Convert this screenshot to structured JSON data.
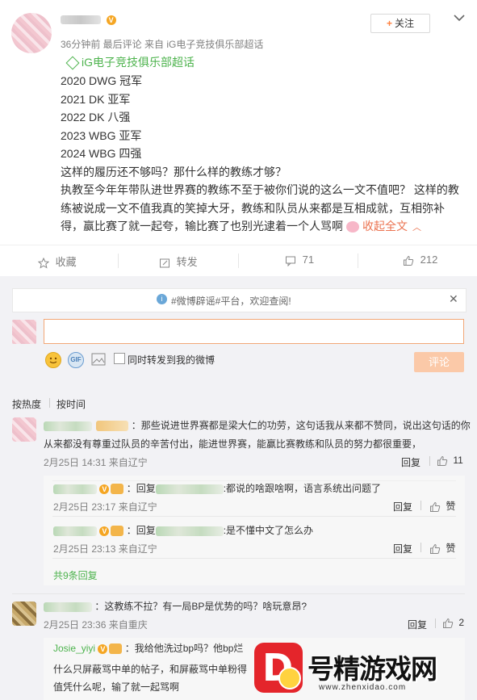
{
  "post": {
    "author_name": "Josie_yiyi",
    "meta": "36分钟前 最后评论 来自 iG电子竞技俱乐部超话",
    "follow_label": "关注",
    "topic_tag": "iG电子竞技俱乐部超话",
    "lines": [
      "2020 DWG 冠军",
      "2021 DK 亚军",
      "2022 DK 八强",
      "2023 WBG 亚军",
      "2024 WBG 四强",
      "这样的履历还不够吗？那什么样的教练才够？",
      "执教至今年年带队进世界赛的教练不至于被你们说的这么一文不值吧？ 这样的教",
      "练被说成一文不值我真的笑掉大牙，教练和队员从来都是互相成就，互相弥补",
      "得，赢比赛了就一起夸，输比赛了也别光逮着一个人骂啊"
    ],
    "collapse_label": "收起全文"
  },
  "actions": {
    "favorite": "收藏",
    "repost": "转发",
    "comments": "71",
    "likes": "212"
  },
  "notice": {
    "text": "#微博辟谣#平台，欢迎查阅!"
  },
  "composer": {
    "sync_label": "同时转发到我的微博",
    "submit_label": "评论"
  },
  "sort": {
    "hot": "按热度",
    "time": "按时间"
  },
  "comments": [
    {
      "text_line1": "：那些说进世界赛都是梁大仁的功劳，这句话我从来都不赞同，说出这句话的你",
      "text_line2": "从来都没有尊重过队员的辛苦付出，能进世界赛，能赢比赛教练和队员的努力都很重要，",
      "meta": "2月25日 14:31 来自辽宁",
      "reply_label": "回复",
      "likes": "11",
      "replies": [
        {
          "prefix": "：回复",
          "text": ":都说的啥跟啥啊，语言系统出问题了",
          "meta": "2月25日 23:17 来自辽宁",
          "reply_label": "回复",
          "like_label": "赞"
        },
        {
          "prefix": "：回复",
          "text": ":是不懂中文了怎么办",
          "meta": "2月25日 23:13 来自辽宁",
          "reply_label": "回复",
          "like_label": "赞"
        }
      ],
      "more_replies": "共9条回复"
    },
    {
      "text_line1": "：这教练不拉？有一局BP是优势的吗？啥玩意昂?",
      "meta": "2月25日 23:36 来自重庆",
      "reply_label": "回复",
      "likes": "2",
      "replies": [
        {
          "author": "Josie_yiyi",
          "line1": "：我给他洗过bp吗？他bp烂",
          "line2": "什么只屏蔽骂中单的帖子，和屏蔽骂中单粉得",
          "line3": "值凭什么呢，输了就一起骂啊"
        }
      ]
    }
  ],
  "watermark": {
    "text": "D号精游戏网",
    "url": "www.zhenxidao.com"
  }
}
